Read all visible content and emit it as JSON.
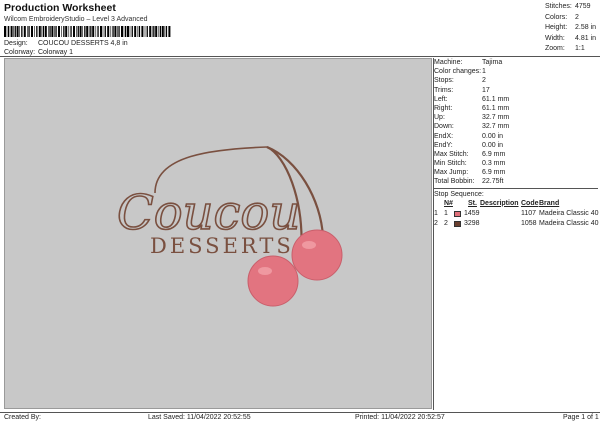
{
  "header": {
    "title": "Production Worksheet",
    "subtitle": "Wilcom EmbroideryStudio – Level 3 Advanced",
    "design_label": "Design:",
    "design_value": "COUCOU DESSERTS 4,8 in",
    "colorway_label": "Colorway:",
    "colorway_value": "Colorway 1"
  },
  "stats": [
    {
      "label": "Stitches:",
      "value": "4759"
    },
    {
      "label": "Colors:",
      "value": "2"
    },
    {
      "label": "Height:",
      "value": "2.58 in"
    },
    {
      "label": "Width:",
      "value": "4.81 in"
    },
    {
      "label": "Zoom:",
      "value": "1:1"
    }
  ],
  "machine_info": [
    {
      "label": "Machine:",
      "value": "Tajima"
    },
    {
      "label": "Color changes:",
      "value": "1"
    },
    {
      "label": "Stops:",
      "value": "2"
    },
    {
      "label": "Trims:",
      "value": "17"
    },
    {
      "label": "Left:",
      "value": "61.1 mm"
    },
    {
      "label": "Right:",
      "value": "61.1 mm"
    },
    {
      "label": "Up:",
      "value": "32.7 mm"
    },
    {
      "label": "Down:",
      "value": "32.7 mm"
    },
    {
      "label": "EndX:",
      "value": "0.00 in"
    },
    {
      "label": "EndY:",
      "value": "0.00 in"
    },
    {
      "label": "Max Stitch:",
      "value": "6.9 mm"
    },
    {
      "label": "Min Stitch:",
      "value": "0.3 mm"
    },
    {
      "label": "Max Jump:",
      "value": "6.9 mm"
    },
    {
      "label": "Total Bobbin:",
      "value": "22.75ft"
    }
  ],
  "stop_sequence": {
    "title": "Stop Sequence:",
    "columns": [
      "N#",
      "St.",
      "Description",
      "Code",
      "Brand"
    ],
    "rows": [
      {
        "stop": "1",
        "n": "1",
        "code_num": "1459",
        "stitches": "1107",
        "brand": "Madeira Classic 40",
        "color": "#e0707a"
      },
      {
        "stop": "2",
        "n": "2",
        "code_num": "3298",
        "stitches": "1058",
        "brand": "Madeira Classic 40",
        "color": "#6b4030"
      }
    ]
  },
  "design_art": {
    "script_text": "Coucou",
    "block_text": "DESSERTS",
    "thread_brown": "#7a5040",
    "thread_pink": "#e27480"
  },
  "footer": {
    "created_by": "Created By:",
    "last_saved": "Last Saved: 11/04/2022 20:52:55",
    "printed": "Printed: 11/04/2022 20:52:57",
    "page": "Page 1 of 1"
  }
}
